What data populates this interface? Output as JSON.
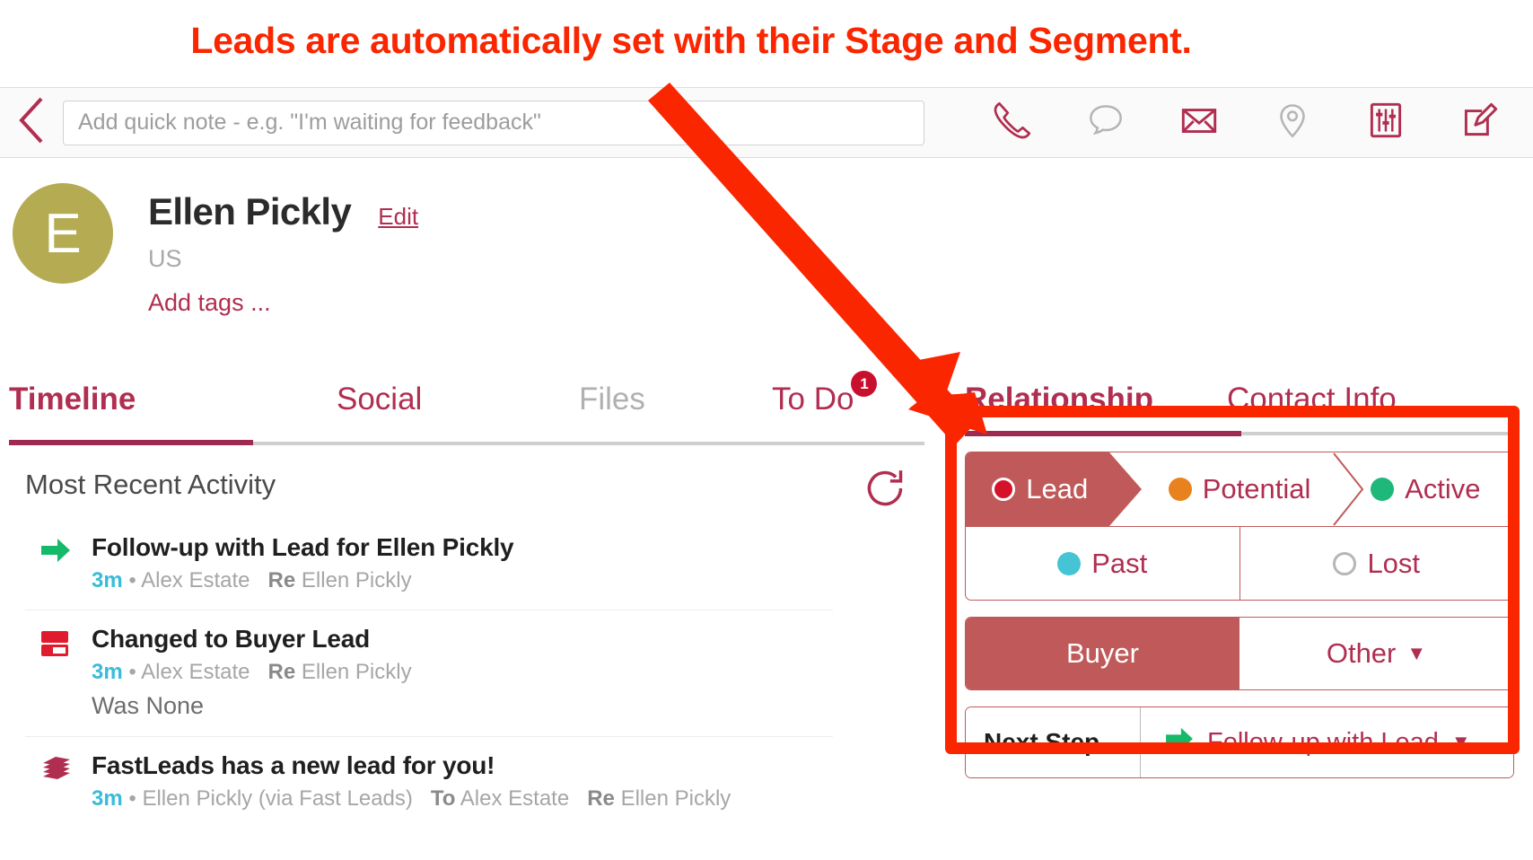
{
  "annotation": {
    "caption": "Leads are automatically set with their Stage and Segment.",
    "color": "#fa2600"
  },
  "toolbar": {
    "back_icon": "chevron-left-icon",
    "note_placeholder": "Add quick note - e.g. \"I'm waiting for feedback\"",
    "note_value": "",
    "icons": [
      {
        "name": "phone-icon",
        "color": "#b02e50"
      },
      {
        "name": "chat-bubble-icon",
        "color": "#b5b5b5"
      },
      {
        "name": "envelope-icon",
        "color": "#b02e50"
      },
      {
        "name": "map-pin-icon",
        "color": "#b5b5b5"
      },
      {
        "name": "sliders-icon",
        "color": "#b02e50"
      },
      {
        "name": "compose-icon",
        "color": "#b02e50"
      }
    ]
  },
  "contact": {
    "avatar_initial": "E",
    "avatar_color": "#b4ab52",
    "name": "Ellen Pickly",
    "edit_label": "Edit",
    "country": "US",
    "add_tags_label": "Add tags ..."
  },
  "left_tabs": [
    {
      "label": "Timeline",
      "active": true
    },
    {
      "label": "Social",
      "active": false
    },
    {
      "label": "Files",
      "active": false,
      "muted": true
    },
    {
      "label": "To Do",
      "active": false,
      "badge": "1"
    }
  ],
  "activity": {
    "header": "Most Recent Activity",
    "refresh_icon": "refresh-icon",
    "items": [
      {
        "icon": "green-arrow-icon",
        "title": "Follow-up with Lead for Ellen Pickly",
        "time": "3m",
        "sep": "•",
        "actor": "Alex Estate",
        "re_label": "Re",
        "re_value": "Ellen Pickly",
        "extra": ""
      },
      {
        "icon": "changed-field-icon",
        "title": "Changed to Buyer Lead",
        "time": "3m",
        "sep": "•",
        "actor": "Alex Estate",
        "re_label": "Re",
        "re_value": "Ellen Pickly",
        "extra": "Was None"
      },
      {
        "icon": "layers-icon",
        "title": "FastLeads has a new lead for you!",
        "time": "3m",
        "sep": "•",
        "actor": "Ellen Pickly (via Fast Leads)",
        "to_label": "To",
        "to_value": "Alex Estate",
        "re_label": "Re",
        "re_value": "Ellen Pickly",
        "extra": ""
      }
    ]
  },
  "right_panel": {
    "tabs": [
      {
        "label": "Relationship",
        "active": true
      },
      {
        "label": "Contact Info",
        "active": false
      }
    ],
    "stages_primary": [
      {
        "label": "Lead",
        "selected": true,
        "dot_color": "#d6122b",
        "dot_style": "ring"
      },
      {
        "label": "Potential",
        "selected": false,
        "dot_color": "#e8821e",
        "dot_style": "solid"
      },
      {
        "label": "Active",
        "selected": false,
        "dot_color": "#1db87a",
        "dot_style": "solid"
      }
    ],
    "stages_secondary": [
      {
        "label": "Past",
        "selected": false,
        "dot_color": "#44c4d4",
        "dot_style": "solid"
      },
      {
        "label": "Lost",
        "selected": false,
        "dot_color": "transparent",
        "dot_style": "hollow"
      }
    ],
    "segments": [
      {
        "label": "Buyer",
        "selected": true
      },
      {
        "label": "Other",
        "selected": false,
        "caret": "▼"
      }
    ],
    "next_step": {
      "label": "Next Step",
      "icon": "green-arrow-icon",
      "value": "Follow-up with Lead",
      "caret": "▼"
    }
  },
  "colors": {
    "brand": "#b02e50",
    "stage_selected": "#c05a5a",
    "annotation": "#fa2600",
    "time": "#38bcd8"
  }
}
